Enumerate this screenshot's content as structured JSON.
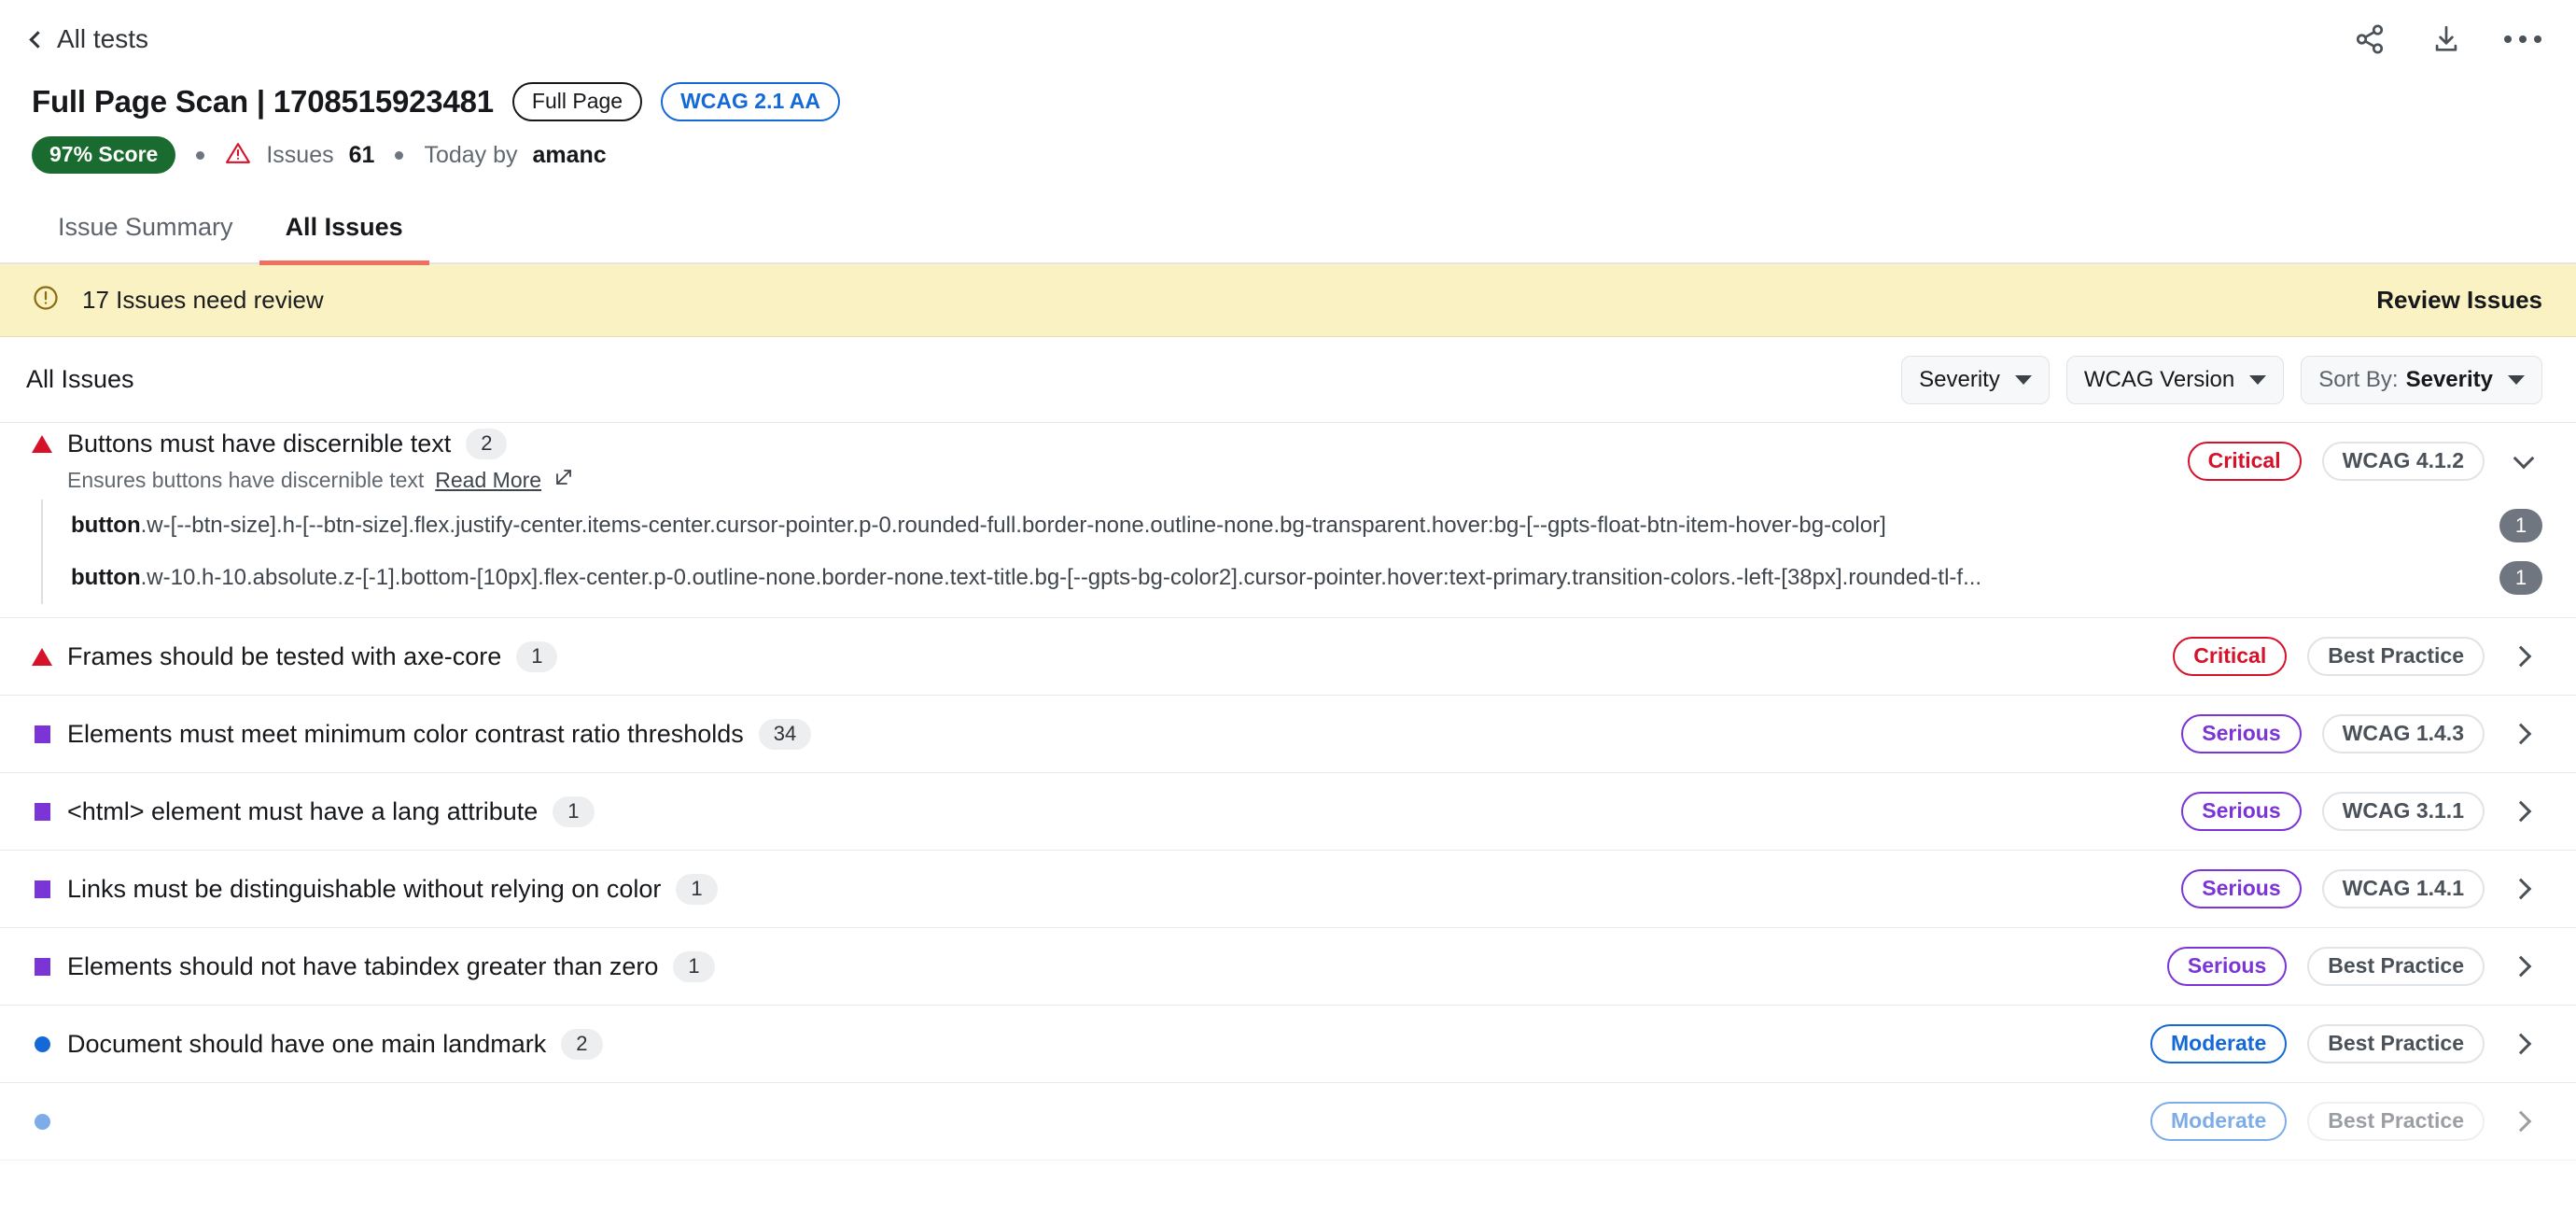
{
  "topbar": {
    "back_label": "All tests",
    "actions": [
      {
        "name": "share-icon",
        "label": "Share"
      },
      {
        "name": "download-icon",
        "label": "Download"
      },
      {
        "name": "more-options-icon",
        "label": "More options"
      }
    ]
  },
  "header": {
    "title": "Full Page Scan | 1708515923481",
    "scope_pill": "Full Page",
    "standard_pill": "WCAG 2.1 AA",
    "score_badge": "97% Score",
    "issues_label": "Issues",
    "issues_count": "61",
    "timestamp": "Today by",
    "author": "amanc"
  },
  "tabs": [
    {
      "label": "Issue Summary",
      "active": false
    },
    {
      "label": "All Issues",
      "active": true
    }
  ],
  "banner": {
    "text": "17 Issues need review",
    "action": "Review Issues",
    "bg_color": "#fbf2c4"
  },
  "filters": {
    "section_label": "All Issues",
    "severity": "Severity",
    "wcag_version": "WCAG Version",
    "sort_by_prefix": "Sort By:",
    "sort_by_value": "Severity"
  },
  "colors": {
    "critical": "#d6122b",
    "serious": "#7b35d6",
    "moderate": "#1569d6",
    "score_green": "#1a6b2f",
    "tab_underline": "#ef6f61",
    "banner": "#fbf2c4"
  },
  "issues": [
    {
      "title": "Buttons must have discernible text",
      "count": "2",
      "severity": "Critical",
      "severity_key": "critical",
      "wcag": "WCAG 4.1.2",
      "description": "Ensures buttons have discernible text",
      "read_more": "Read More",
      "expanded": true,
      "elements": [
        {
          "tag": "button",
          "selector": ".w-[--btn-size].h-[--btn-size].flex.justify-center.items-center.cursor-pointer.p-0.rounded-full.border-none.outline-none.bg-transparent.hover:bg-[--gpts-float-btn-item-hover-bg-color]",
          "count": "1"
        },
        {
          "tag": "button",
          "selector": ".w-10.h-10.absolute.z-[-1].bottom-[10px].flex-center.p-0.outline-none.border-none.text-title.bg-[--gpts-bg-color2].cursor-pointer.hover:text-primary.transition-colors.-left-[38px].rounded-tl-f...",
          "count": "1"
        }
      ]
    },
    {
      "title": "Frames should be tested with axe-core",
      "count": "1",
      "severity": "Critical",
      "severity_key": "critical",
      "wcag": "Best Practice",
      "expanded": false,
      "elements": []
    },
    {
      "title": "Elements must meet minimum color contrast ratio thresholds",
      "count": "34",
      "severity": "Serious",
      "severity_key": "serious",
      "wcag": "WCAG 1.4.3",
      "expanded": false,
      "elements": []
    },
    {
      "title": "<html> element must have a lang attribute",
      "count": "1",
      "severity": "Serious",
      "severity_key": "serious",
      "wcag": "WCAG 3.1.1",
      "expanded": false,
      "elements": []
    },
    {
      "title": "Links must be distinguishable without relying on color",
      "count": "1",
      "severity": "Serious",
      "severity_key": "serious",
      "wcag": "WCAG 1.4.1",
      "expanded": false,
      "elements": []
    },
    {
      "title": "Elements should not have tabindex greater than zero",
      "count": "1",
      "severity": "Serious",
      "severity_key": "serious",
      "wcag": "Best Practice",
      "expanded": false,
      "elements": []
    },
    {
      "title": "Document should have one main landmark",
      "count": "2",
      "severity": "Moderate",
      "severity_key": "moderate",
      "wcag": "Best Practice",
      "expanded": false,
      "elements": []
    }
  ],
  "partial_row": {
    "severity": "Moderate",
    "severity_key": "moderate",
    "wcag": "Best Practice"
  }
}
